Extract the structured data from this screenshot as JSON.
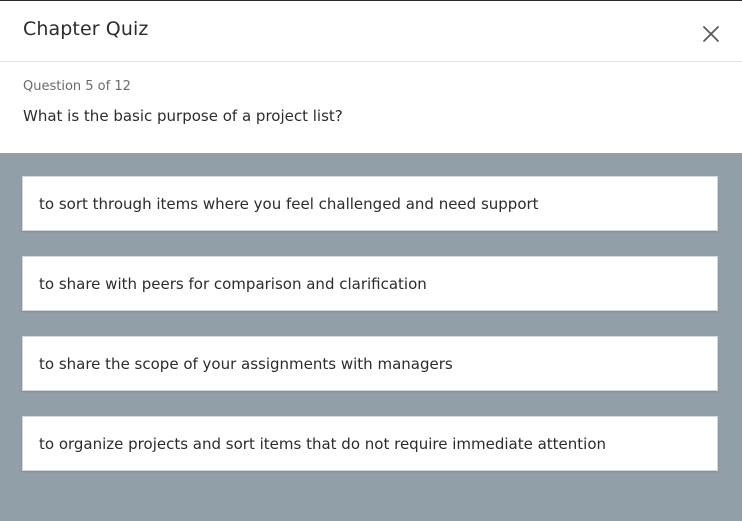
{
  "header": {
    "title": "Chapter Quiz",
    "close_icon": "close-icon"
  },
  "question": {
    "counter": "Question 5 of 12",
    "text": "What is the basic purpose of a project list?"
  },
  "options": [
    {
      "label": "to sort through items where you feel challenged and need support"
    },
    {
      "label": "to share with peers for comparison and clarification"
    },
    {
      "label": "to share the scope of your assignments with managers"
    },
    {
      "label": "to organize projects and sort items that do not require immediate attention"
    }
  ],
  "colors": {
    "answers_background": "#919fa9",
    "option_background": "#ffffff",
    "text": "#2c2c2c"
  }
}
